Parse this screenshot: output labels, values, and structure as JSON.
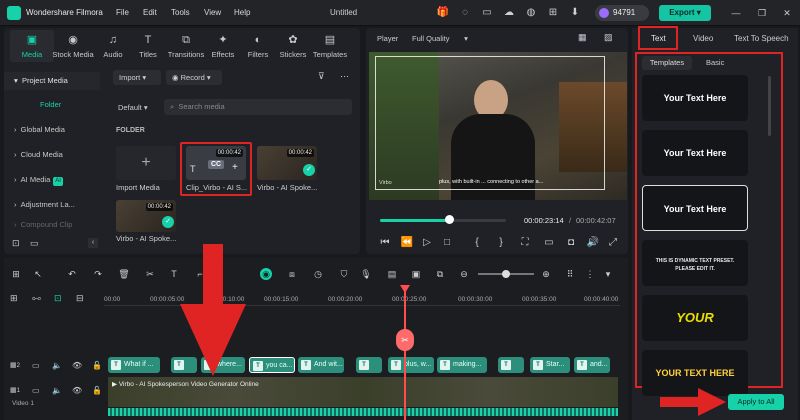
{
  "app": {
    "name": "Wondershare Filmora",
    "window_title": "Untitled",
    "credits": "94791",
    "export": "Export"
  },
  "menu": [
    "File",
    "Edit",
    "Tools",
    "View",
    "Help"
  ],
  "media_tabs": [
    {
      "label": "Media",
      "icon": "media-icon"
    },
    {
      "label": "Stock Media",
      "icon": "stock-media-icon"
    },
    {
      "label": "Audio",
      "icon": "audio-icon"
    },
    {
      "label": "Titles",
      "icon": "titles-icon"
    },
    {
      "label": "Transitions",
      "icon": "transitions-icon"
    },
    {
      "label": "Effects",
      "icon": "effects-icon"
    },
    {
      "label": "Filters",
      "icon": "filters-icon"
    },
    {
      "label": "Stickers",
      "icon": "stickers-icon"
    },
    {
      "label": "Templates",
      "icon": "templates-icon"
    }
  ],
  "sidebar": {
    "items": [
      "Project Media",
      "Folder",
      "Global Media",
      "Cloud Media",
      "AI Media",
      "Adjustment La...",
      "Compound Clip"
    ],
    "ai_badge": "AI"
  },
  "library": {
    "import": "Import",
    "record": "Record",
    "sort": "Default",
    "search_placeholder": "Search media",
    "folder_label": "FOLDER",
    "items": [
      {
        "caption": "Import Media",
        "duration": ""
      },
      {
        "caption": "Clip_Virbo - AI S...",
        "duration": "00:00:42",
        "badge": "CC"
      },
      {
        "caption": "Virbo - AI Spoke...",
        "duration": "00:00:42"
      },
      {
        "caption": "Virbo - AI Spoke...",
        "duration": "00:00:42"
      }
    ]
  },
  "player": {
    "label": "Player",
    "quality": "Full Quality",
    "caption_text": "plus, with built-in ... connecting to other a...",
    "watermark": "Virbo",
    "current_time": "00:00:23:14",
    "total_time": "00:00:42:07",
    "progress": 0.55
  },
  "right_panel": {
    "tabs": [
      "Text",
      "Video",
      "Text To Speech"
    ],
    "subtabs": [
      "Templates",
      "Basic"
    ],
    "templates": [
      "Your Text Here",
      "Your Text Here",
      "Your Text Here",
      "THIS IS DYNAMIC TEXT PRESET. PLEASE EDIT IT.",
      "YOUR",
      "YOUR TEXT HERE"
    ],
    "apply_all": "Apply to All"
  },
  "timeline": {
    "ruler": [
      "00:00",
      "00:00:05:00",
      "00:00:10:00",
      "00:00:15:00",
      "00:00:20:00",
      "00:00:25:00",
      "00:00:30:00",
      "00:00:35:00",
      "00:00:40:00"
    ],
    "text_clips": [
      "What if ...",
      "",
      "where...",
      "you ca...",
      "And wit...",
      "",
      "plus, w...",
      "making...",
      "",
      "Star...",
      "and..."
    ],
    "video_clip": "Virbo - AI Spokesperson Video Generator Online",
    "track2": "2",
    "track1": "1",
    "video_label": "Video 1"
  }
}
